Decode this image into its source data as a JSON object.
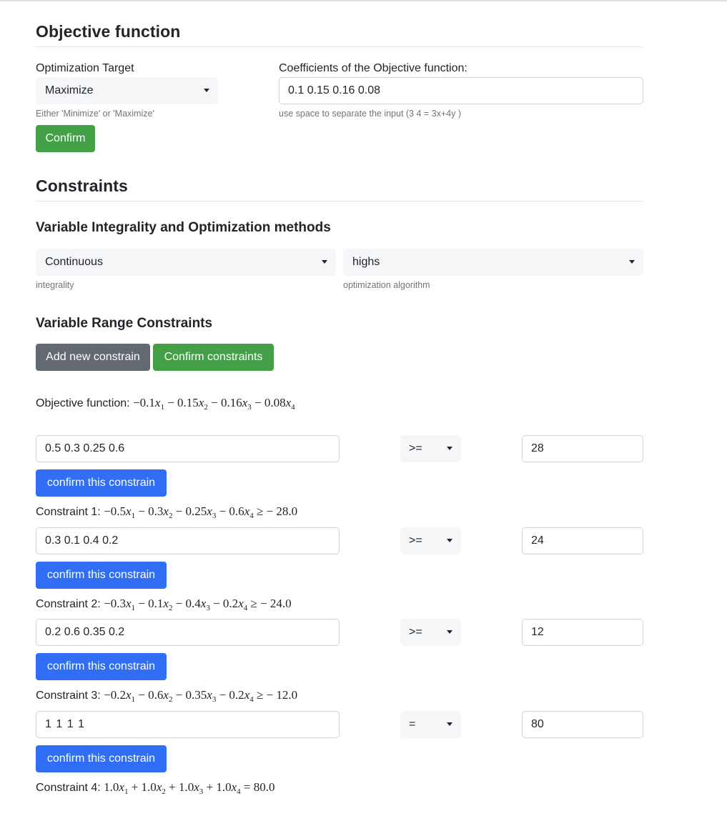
{
  "objective_section": {
    "title": "Objective function",
    "target_label": "Optimization Target",
    "target_value": "Maximize",
    "target_help": "Either 'Minimize' or 'Maximize'",
    "coeff_label": "Coefficients of the Objective function:",
    "coeff_value": "0.1 0.15 0.16 0.08",
    "coeff_help": "use space to separate the input (3 4 = 3x+4y )",
    "confirm_label": "Confirm"
  },
  "constraints_section": {
    "title": "Constraints",
    "integrality_title": "Variable Integrality and Optimization methods",
    "integrality_value": "Continuous",
    "integrality_help": "integrality",
    "algorithm_value": "highs",
    "algorithm_help": "optimization algorithm",
    "range_title": "Variable Range Constraints",
    "add_label": "Add new constrain",
    "confirm_all_label": "Confirm constraints",
    "objective_prefix": "Objective function:",
    "objective_terms": [
      {
        "sign": "−",
        "coef": "0.1",
        "var": "x",
        "idx": "1"
      },
      {
        "sign": "−",
        "coef": "0.15",
        "var": "x",
        "idx": "2"
      },
      {
        "sign": "−",
        "coef": "0.16",
        "var": "x",
        "idx": "3"
      },
      {
        "sign": "−",
        "coef": "0.08",
        "var": "x",
        "idx": "4"
      }
    ],
    "constraint_button_label": "confirm this constrain",
    "constraints": [
      {
        "coefficients": "0.5 0.3 0.25 0.6",
        "operator": ">=",
        "rhs": "28",
        "label": "Constraint 1:",
        "terms": [
          {
            "sign": "−",
            "coef": "0.5",
            "idx": "1"
          },
          {
            "sign": "−",
            "coef": "0.3",
            "idx": "2"
          },
          {
            "sign": "−",
            "coef": "0.25",
            "idx": "3"
          },
          {
            "sign": "−",
            "coef": "0.6",
            "idx": "4"
          }
        ],
        "relation": "≥",
        "result": "− 28.0"
      },
      {
        "coefficients": "0.3 0.1 0.4 0.2",
        "operator": ">=",
        "rhs": "24",
        "label": "Constraint 2:",
        "terms": [
          {
            "sign": "−",
            "coef": "0.3",
            "idx": "1"
          },
          {
            "sign": "−",
            "coef": "0.1",
            "idx": "2"
          },
          {
            "sign": "−",
            "coef": "0.4",
            "idx": "3"
          },
          {
            "sign": "−",
            "coef": "0.2",
            "idx": "4"
          }
        ],
        "relation": "≥",
        "result": "− 24.0"
      },
      {
        "coefficients": "0.2 0.6 0.35 0.2",
        "operator": ">=",
        "rhs": "12",
        "label": "Constraint 3:",
        "terms": [
          {
            "sign": "−",
            "coef": "0.2",
            "idx": "1"
          },
          {
            "sign": "−",
            "coef": "0.6",
            "idx": "2"
          },
          {
            "sign": "−",
            "coef": "0.35",
            "idx": "3"
          },
          {
            "sign": "−",
            "coef": "0.2",
            "idx": "4"
          }
        ],
        "relation": "≥",
        "result": "− 12.0"
      },
      {
        "coefficients": "1 1 1 1",
        "operator": "=",
        "rhs": "80",
        "label": "Constraint 4:",
        "terms": [
          {
            "sign": "",
            "coef": "1.0",
            "idx": "1"
          },
          {
            "sign": "+",
            "coef": "1.0",
            "idx": "2"
          },
          {
            "sign": "+",
            "coef": "1.0",
            "idx": "3"
          },
          {
            "sign": "+",
            "coef": "1.0",
            "idx": "4"
          }
        ],
        "relation": "=",
        "result": "80.0"
      }
    ]
  },
  "colors": {
    "confirm_green": "#43a047",
    "secondary_gray": "#636970",
    "primary_blue": "#2f6ef5"
  }
}
